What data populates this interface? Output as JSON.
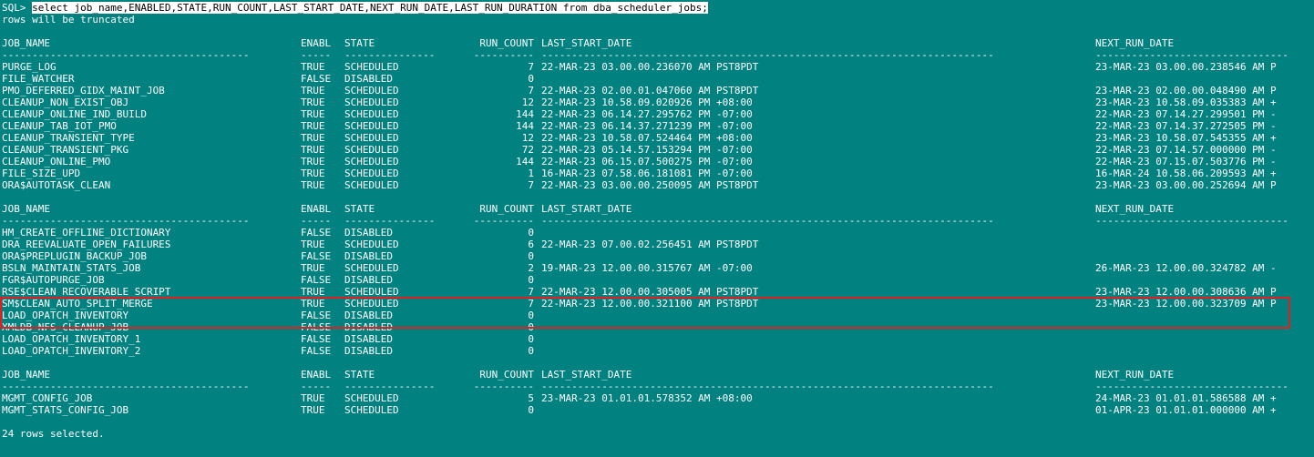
{
  "prompt": "SQL> ",
  "command": "select job_name,ENABLED,STATE,RUN_COUNT,LAST_START_DATE,NEXT_RUN_DATE,LAST_RUN_DURATION from dba_scheduler_jobs;",
  "warning": "rows will be truncated",
  "headers": {
    "job_name": "JOB_NAME",
    "enabled": "ENABL",
    "state": "STATE",
    "run_count": "RUN_COUNT",
    "last_start_date": "LAST_START_DATE",
    "next_run_date": "NEXT_RUN_DATE"
  },
  "separators": {
    "job_name": "-----------------------------------------",
    "enabled": "-----",
    "state": "---------------",
    "run_count": "----------",
    "last_start_date": "---------------------------------------------------------------------------",
    "next_run_date": "--------------------------------"
  },
  "groups": [
    {
      "rows": [
        {
          "job_name": "PURGE_LOG",
          "enabled": "TRUE",
          "state": "SCHEDULED",
          "run_count": "7",
          "last_start_date": "22-MAR-23 03.00.00.236070 AM PST8PDT",
          "next_run_date": "23-MAR-23 03.00.00.238546 AM P"
        },
        {
          "job_name": "FILE_WATCHER",
          "enabled": "FALSE",
          "state": "DISABLED",
          "run_count": "0",
          "last_start_date": "",
          "next_run_date": ""
        },
        {
          "job_name": "PMO_DEFERRED_GIDX_MAINT_JOB",
          "enabled": "TRUE",
          "state": "SCHEDULED",
          "run_count": "7",
          "last_start_date": "22-MAR-23 02.00.01.047060 AM PST8PDT",
          "next_run_date": "23-MAR-23 02.00.00.048490 AM P"
        },
        {
          "job_name": "CLEANUP_NON_EXIST_OBJ",
          "enabled": "TRUE",
          "state": "SCHEDULED",
          "run_count": "12",
          "last_start_date": "22-MAR-23 10.58.09.020926 PM +08:00",
          "next_run_date": "23-MAR-23 10.58.09.035383 AM +"
        },
        {
          "job_name": "CLEANUP_ONLINE_IND_BUILD",
          "enabled": "TRUE",
          "state": "SCHEDULED",
          "run_count": "144",
          "last_start_date": "22-MAR-23 06.14.27.295762 PM -07:00",
          "next_run_date": "22-MAR-23 07.14.27.299501 PM -"
        },
        {
          "job_name": "CLEANUP_TAB_IOT_PMO",
          "enabled": "TRUE",
          "state": "SCHEDULED",
          "run_count": "144",
          "last_start_date": "22-MAR-23 06.14.37.271239 PM -07:00",
          "next_run_date": "22-MAR-23 07.14.37.272505 PM -"
        },
        {
          "job_name": "CLEANUP_TRANSIENT_TYPE",
          "enabled": "TRUE",
          "state": "SCHEDULED",
          "run_count": "12",
          "last_start_date": "22-MAR-23 10.58.07.524464 PM +08:00",
          "next_run_date": "23-MAR-23 10.58.07.545355 AM +"
        },
        {
          "job_name": "CLEANUP_TRANSIENT_PKG",
          "enabled": "TRUE",
          "state": "SCHEDULED",
          "run_count": "72",
          "last_start_date": "22-MAR-23 05.14.57.153294 PM -07:00",
          "next_run_date": "22-MAR-23 07.14.57.000000 PM -"
        },
        {
          "job_name": "CLEANUP_ONLINE_PMO",
          "enabled": "TRUE",
          "state": "SCHEDULED",
          "run_count": "144",
          "last_start_date": "22-MAR-23 06.15.07.500275 PM -07:00",
          "next_run_date": "22-MAR-23 07.15.07.503776 PM -"
        },
        {
          "job_name": "FILE_SIZE_UPD",
          "enabled": "TRUE",
          "state": "SCHEDULED",
          "run_count": "1",
          "last_start_date": "16-MAR-23 07.58.06.181081 PM -07:00",
          "next_run_date": "16-MAR-24 10.58.06.209593 AM +"
        },
        {
          "job_name": "ORA$AUTOTASK_CLEAN",
          "enabled": "TRUE",
          "state": "SCHEDULED",
          "run_count": "7",
          "last_start_date": "22-MAR-23 03.00.00.250095 AM PST8PDT",
          "next_run_date": "23-MAR-23 03.00.00.252694 AM P"
        }
      ]
    },
    {
      "rows": [
        {
          "job_name": "HM_CREATE_OFFLINE_DICTIONARY",
          "enabled": "FALSE",
          "state": "DISABLED",
          "run_count": "0",
          "last_start_date": "",
          "next_run_date": ""
        },
        {
          "job_name": "DRA_REEVALUATE_OPEN_FAILURES",
          "enabled": "TRUE",
          "state": "SCHEDULED",
          "run_count": "6",
          "last_start_date": "22-MAR-23 07.00.02.256451 AM PST8PDT",
          "next_run_date": ""
        },
        {
          "job_name": "ORA$PREPLUGIN_BACKUP_JOB",
          "enabled": "FALSE",
          "state": "DISABLED",
          "run_count": "0",
          "last_start_date": "",
          "next_run_date": ""
        },
        {
          "job_name": "BSLN_MAINTAIN_STATS_JOB",
          "enabled": "TRUE",
          "state": "SCHEDULED",
          "run_count": "2",
          "last_start_date": "19-MAR-23 12.00.00.315767 AM -07:00",
          "next_run_date": "26-MAR-23 12.00.00.324782 AM -"
        },
        {
          "job_name": "FGR$AUTOPURGE_JOB",
          "enabled": "FALSE",
          "state": "DISABLED",
          "run_count": "0",
          "last_start_date": "",
          "next_run_date": ""
        },
        {
          "job_name": "RSE$CLEAN_RECOVERABLE_SCRIPT",
          "enabled": "TRUE",
          "state": "SCHEDULED",
          "run_count": "7",
          "last_start_date": "22-MAR-23 12.00.00.305005 AM PST8PDT",
          "next_run_date": "23-MAR-23 12.00.00.308636 AM P"
        },
        {
          "job_name": "SM$CLEAN_AUTO_SPLIT_MERGE",
          "enabled": "TRUE",
          "state": "SCHEDULED",
          "run_count": "7",
          "last_start_date": "22-MAR-23 12.00.00.321100 AM PST8PDT",
          "next_run_date": "23-MAR-23 12.00.00.323709 AM P"
        },
        {
          "job_name": "LOAD_OPATCH_INVENTORY",
          "enabled": "FALSE",
          "state": "DISABLED",
          "run_count": "0",
          "last_start_date": "",
          "next_run_date": ""
        },
        {
          "job_name": "XMLDB_NFS_CLEANUP_JOB",
          "enabled": "FALSE",
          "state": "DISABLED",
          "run_count": "0",
          "last_start_date": "",
          "next_run_date": ""
        },
        {
          "job_name": "LOAD_OPATCH_INVENTORY_1",
          "enabled": "FALSE",
          "state": "DISABLED",
          "run_count": "0",
          "last_start_date": "",
          "next_run_date": ""
        },
        {
          "job_name": "LOAD_OPATCH_INVENTORY_2",
          "enabled": "FALSE",
          "state": "DISABLED",
          "run_count": "0",
          "last_start_date": "",
          "next_run_date": ""
        }
      ]
    },
    {
      "rows": [
        {
          "job_name": "MGMT_CONFIG_JOB",
          "enabled": "TRUE",
          "state": "SCHEDULED",
          "run_count": "5",
          "last_start_date": "23-MAR-23 01.01.01.578352 AM +08:00",
          "next_run_date": "24-MAR-23 01.01.01.586588 AM +"
        },
        {
          "job_name": "MGMT_STATS_CONFIG_JOB",
          "enabled": "TRUE",
          "state": "SCHEDULED",
          "run_count": "0",
          "last_start_date": "",
          "next_run_date": "01-APR-23 01.01.01.000000 AM +"
        }
      ]
    }
  ],
  "footer": "24 rows selected.",
  "highlight_color": "#e02020",
  "background_color": "#028181"
}
